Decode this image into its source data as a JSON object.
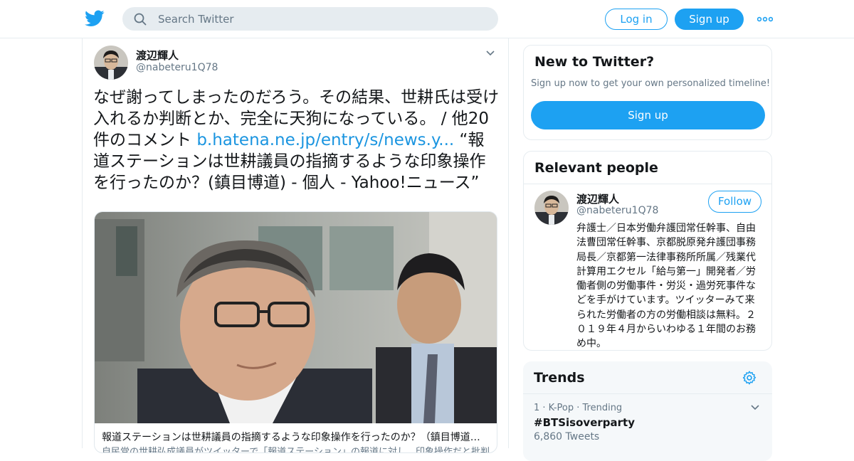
{
  "header": {
    "search_placeholder": "Search Twitter",
    "login_label": "Log in",
    "signup_label": "Sign up",
    "more_icon": "more-dots-icon",
    "brand_color": "#1da1f2"
  },
  "tweet": {
    "author_name": "渡辺輝人",
    "author_handle": "@nabeteru1Q78",
    "text_before_link": "なぜ謝ってしまったのだろう。その結果、世耕氏は受け入れるか判断とか、完全に天狗になっている。 / 他20件のコメント ",
    "link_text": "b.hatena.ne.jp/entry/s/news.y...",
    "text_after_link": " “報道ステーションは世耕議員の指摘するような印象操作を行ったのか？(鎮目博道) - 個人 - Yahoo!ニュース”",
    "card": {
      "title": "報道ステーションは世耕議員の指摘するような印象操作を行ったのか？（鎮目博道） - 個人 - Yahoo!ニュース",
      "description": "自民党の世耕弘成議員がツイッターで「報道ステーション」の報道に対し、印象操作だと批判した"
    }
  },
  "sidebar": {
    "new_to_twitter": {
      "title": "New to Twitter?",
      "subtitle": "Sign up now to get your own personalized timeline!",
      "button_label": "Sign up"
    },
    "relevant_people": {
      "title": "Relevant people",
      "person": {
        "name": "渡辺輝人",
        "handle": "@nabeteru1Q78",
        "follow_label": "Follow",
        "bio": "弁護士／日本労働弁護団常任幹事、自由法曹団常任幹事、京都脱原発弁護団事務局長／京都第一法律事務所所属／残業代計算用エクセル「給与第一」開発者／労働者側の労働事件・労災・過労死事件などを手がけています。ツイッターみて来られた労働者の方の労働相談は無料。２０１９年４月からいわゆる１年間のお務め中。"
      }
    },
    "trends": {
      "title": "Trends",
      "items": [
        {
          "meta": "1 · K-Pop · Trending",
          "tag": "#BTSisoverparty",
          "count": "6,860 Tweets"
        }
      ]
    }
  }
}
